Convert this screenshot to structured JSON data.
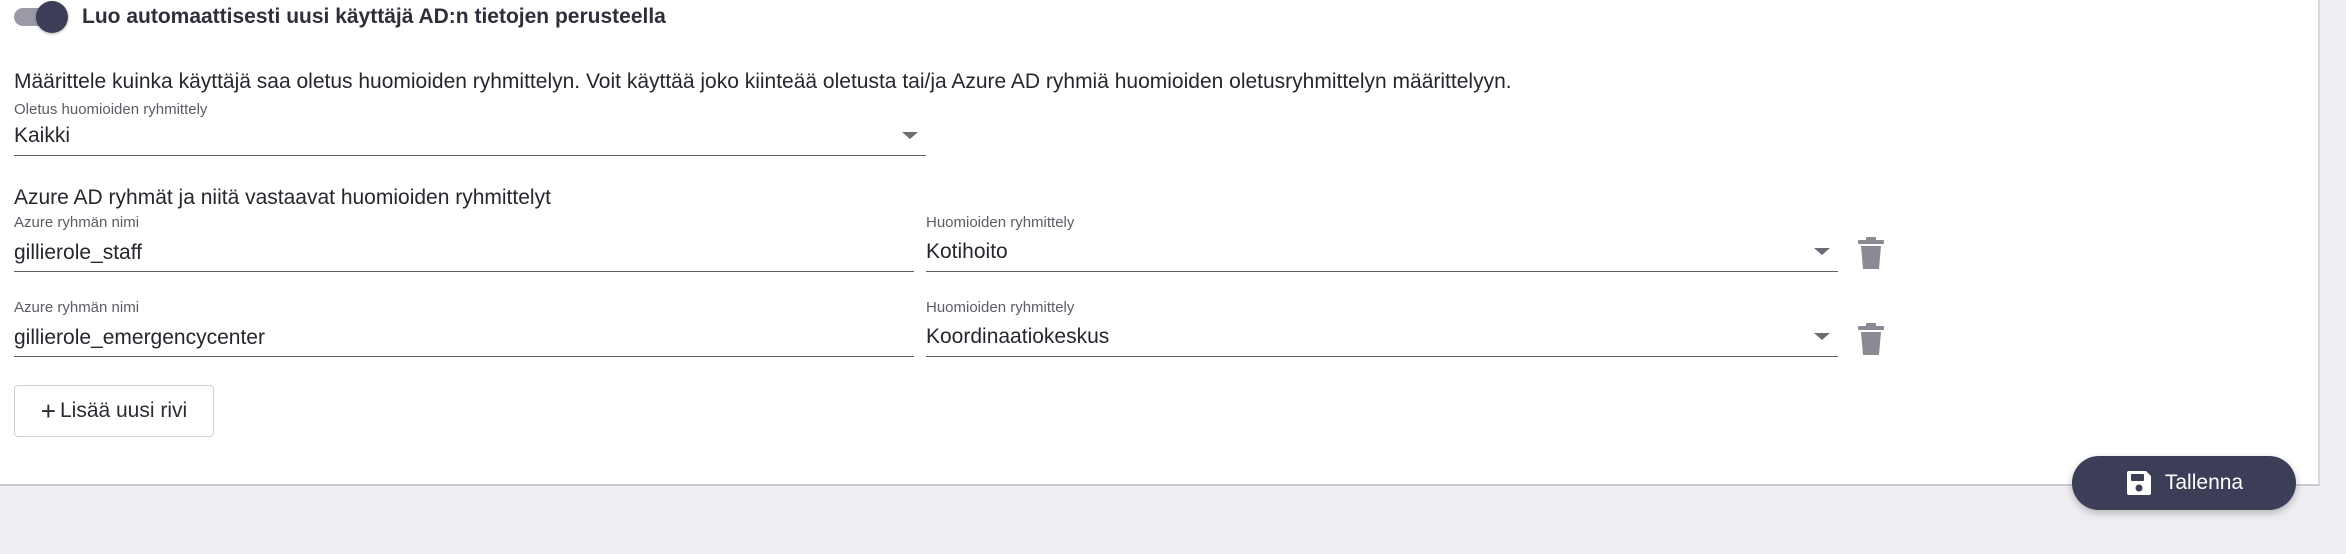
{
  "auto_create": {
    "label": "Luo automaattisesti uusi käyttäjä AD:n tietojen perusteella",
    "enabled": true
  },
  "description": "Määrittele kuinka käyttäjä saa oletus huomioiden ryhmittelyn. Voit käyttää joko kiinteää oletusta tai/ja Azure AD ryhmiä huomioiden oletusryhmittelyn määrittelyyn.",
  "default_grouping": {
    "caption": "Oletus huomioiden ryhmittely",
    "value": "Kaikki"
  },
  "azure_section": {
    "title": "Azure AD ryhmät ja niitä vastaavat huomioiden ryhmittelyt",
    "rows": [
      {
        "group_caption": "Azure ryhmän nimi",
        "group_value": "gillierole_staff",
        "grouping_caption": "Huomioiden ryhmittely",
        "grouping_value": "Kotihoito"
      },
      {
        "group_caption": "Azure ryhmän nimi",
        "group_value": "gillierole_emergencycenter",
        "grouping_caption": "Huomioiden ryhmittely",
        "grouping_value": "Koordinaatiokeskus"
      }
    ]
  },
  "add_row_label": "Lisää uusi rivi",
  "save_label": "Tallenna",
  "icons": {
    "add": "plus-icon",
    "delete": "trash-icon",
    "save": "floppy-disk-icon",
    "dropdown": "caret-down-icon"
  },
  "colors": {
    "accent": "#3c3d57",
    "background": "#efeef2",
    "card": "#ffffff"
  }
}
